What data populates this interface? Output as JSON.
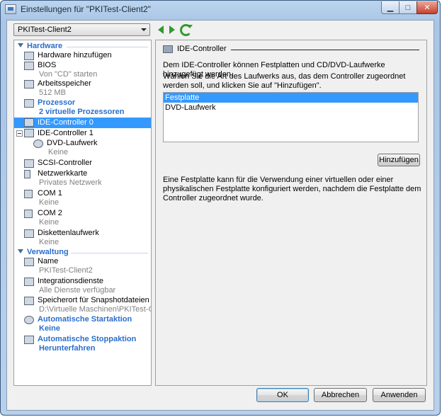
{
  "window": {
    "title": "Einstellungen für \"PKITest-Client2\""
  },
  "toolbar": {
    "vm_selected": "PKITest-Client2"
  },
  "sidebar": {
    "hardware_heading": "Hardware",
    "management_heading": "Verwaltung",
    "items": [
      {
        "primary": "Hardware hinzufügen",
        "secondary": ""
      },
      {
        "primary": "BIOS",
        "secondary": "Von \"CD\" starten"
      },
      {
        "primary": "Arbeitsspeicher",
        "secondary": "512 MB"
      },
      {
        "primary": "Prozessor",
        "secondary": "2 virtuelle Prozessoren"
      },
      {
        "primary": "IDE-Controller 0",
        "secondary": ""
      },
      {
        "primary": "IDE-Controller 1",
        "secondary": ""
      },
      {
        "primary": "DVD-Laufwerk",
        "secondary": "Keine"
      },
      {
        "primary": "SCSI-Controller",
        "secondary": ""
      },
      {
        "primary": "Netzwerkkarte",
        "secondary": "Privates Netzwerk"
      },
      {
        "primary": "COM 1",
        "secondary": "Keine"
      },
      {
        "primary": "COM 2",
        "secondary": "Keine"
      },
      {
        "primary": "Diskettenlaufwerk",
        "secondary": "Keine"
      }
    ],
    "management_items": [
      {
        "primary": "Name",
        "secondary": "PKITest-Client2"
      },
      {
        "primary": "Integrationsdienste",
        "secondary": "Alle Dienste verfügbar"
      },
      {
        "primary": "Speicherort für Snapshotdateien",
        "secondary": "D:\\Virtuelle Maschinen\\PKITest-Cli..."
      },
      {
        "primary": "Automatische Startaktion",
        "secondary": "Keine"
      },
      {
        "primary": "Automatische Stoppaktion",
        "secondary": "Herunterfahren"
      }
    ]
  },
  "panel": {
    "title": "IDE-Controller",
    "description": "Dem IDE-Controller können Festplatten und CD/DVD-Laufwerke hinzugefügt werden.",
    "instruction": "Wählen Sie die Art des Laufwerks aus, das dem Controller zugeordnet werden soll, und klicken Sie auf \"Hinzufügen\".",
    "drive_types": [
      "Festplatte",
      "DVD-Laufwerk"
    ],
    "add_label": "Hinzufügen",
    "help_text": "Eine Festplatte kann für die Verwendung einer virtuellen oder einer physikalischen Festplatte konfiguriert werden, nachdem die Festplatte dem Controller zugeordnet wurde."
  },
  "footer": {
    "ok": "OK",
    "cancel": "Abbrechen",
    "apply": "Anwenden"
  },
  "colors": {
    "accent": "#2a6ecc",
    "selection": "#3399ff"
  }
}
